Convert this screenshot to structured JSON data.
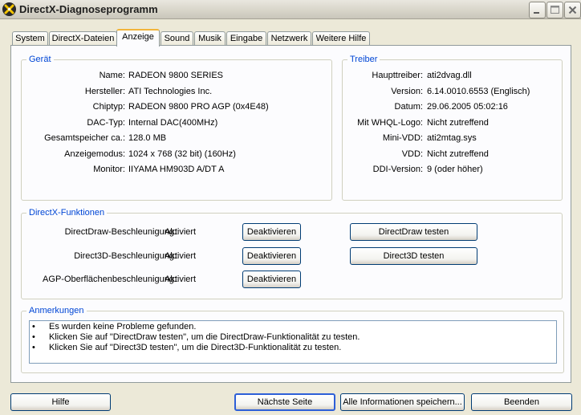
{
  "window": {
    "title": "DirectX-Diagnoseprogramm"
  },
  "tabs": [
    {
      "label": "System",
      "active": false
    },
    {
      "label": "DirectX-Dateien",
      "active": false
    },
    {
      "label": "Anzeige",
      "active": true
    },
    {
      "label": "Sound",
      "active": false
    },
    {
      "label": "Musik",
      "active": false
    },
    {
      "label": "Eingabe",
      "active": false
    },
    {
      "label": "Netzwerk",
      "active": false
    },
    {
      "label": "Weitere Hilfe",
      "active": false
    }
  ],
  "device": {
    "title": "Gerät",
    "rows": [
      {
        "label": "Name:",
        "value": "RADEON 9800 SERIES"
      },
      {
        "label": "Hersteller:",
        "value": "ATI Technologies Inc."
      },
      {
        "label": "Chiptyp:",
        "value": "RADEON 9800 PRO AGP (0x4E48)"
      },
      {
        "label": "DAC-Typ:",
        "value": "Internal DAC(400MHz)"
      },
      {
        "label": "Gesamtspeicher ca.:",
        "value": "128.0 MB"
      },
      {
        "label": "Anzeigemodus:",
        "value": "1024 x 768 (32 bit) (160Hz)"
      },
      {
        "label": "Monitor:",
        "value": "IIYAMA HM903D A/DT A"
      }
    ]
  },
  "driver": {
    "title": "Treiber",
    "rows": [
      {
        "label": "Haupttreiber:",
        "value": "ati2dvag.dll"
      },
      {
        "label": "Version:",
        "value": "6.14.0010.6553 (Englisch)"
      },
      {
        "label": "Datum:",
        "value": "29.06.2005 05:02:16"
      },
      {
        "label": "Mit WHQL-Logo:",
        "value": "Nicht zutreffend"
      },
      {
        "label": "Mini-VDD:",
        "value": "ati2mtag.sys"
      },
      {
        "label": "VDD:",
        "value": "Nicht zutreffend"
      },
      {
        "label": "DDI-Version:",
        "value": "9 (oder höher)"
      }
    ]
  },
  "features": {
    "title": "DirectX-Funktionen",
    "rows": [
      {
        "label": "DirectDraw-Beschleunigung:",
        "status": "Aktiviert",
        "toggle_label": "Deaktivieren",
        "test_label": "DirectDraw testen"
      },
      {
        "label": "Direct3D-Beschleunigung:",
        "status": "Aktiviert",
        "toggle_label": "Deaktivieren",
        "test_label": "Direct3D testen"
      },
      {
        "label": "AGP-Oberflächenbeschleunigung:",
        "status": "Aktiviert",
        "toggle_label": "Deaktivieren"
      }
    ]
  },
  "notes": {
    "title": "Anmerkungen",
    "bullet": "•",
    "items": [
      "Es wurden keine Probleme gefunden.",
      "Klicken Sie auf \"DirectDraw testen\", um die DirectDraw-Funktionalität zu testen.",
      "Klicken Sie auf \"Direct3D testen\", um die Direct3D-Funktionalität zu testen."
    ]
  },
  "footer": {
    "help_label": "Hilfe",
    "next_label": "Nächste Seite",
    "save_label": "Alle Informationen speichern...",
    "exit_label": "Beenden"
  },
  "colors": {
    "group_title": "#0046d5",
    "panel_bg": "#fcfcfe",
    "window_bg": "#ece9d8",
    "active_tab_accent": "#f2b53a"
  }
}
